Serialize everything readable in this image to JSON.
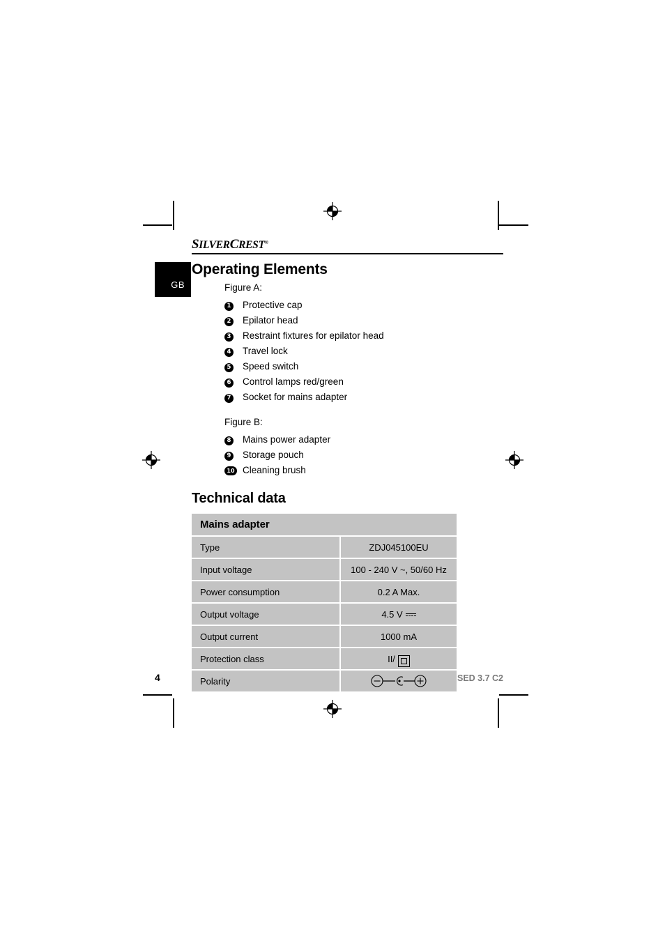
{
  "brand": {
    "name_part1": "S",
    "name_part2": "ILVER",
    "name_part3": "C",
    "name_part4": "REST",
    "registered_mark": "®"
  },
  "language_badge": "GB",
  "sections": {
    "operating_elements": {
      "title": "Operating Elements",
      "figure_a": {
        "label": "Figure A:",
        "items": [
          {
            "number": "1",
            "label": "Protective cap"
          },
          {
            "number": "2",
            "label": "Epilator head"
          },
          {
            "number": "3",
            "label": "Restraint fixtures for epilator head"
          },
          {
            "number": "4",
            "label": "Travel lock"
          },
          {
            "number": "5",
            "label": "Speed switch"
          },
          {
            "number": "6",
            "label": "Control lamps red/green"
          },
          {
            "number": "7",
            "label": "Socket for mains adapter"
          }
        ]
      },
      "figure_b": {
        "label": "Figure B:",
        "items": [
          {
            "number": "8",
            "label": "Mains power adapter"
          },
          {
            "number": "9",
            "label": "Storage pouch"
          },
          {
            "number": "10",
            "label": "Cleaning brush"
          }
        ]
      }
    },
    "technical_data": {
      "title": "Technical data",
      "table_header": "Mains adapter",
      "rows": [
        {
          "label": "Type",
          "value": "ZDJ045100EU",
          "symbol": "none"
        },
        {
          "label": "Input voltage",
          "value": "100 - 240 V ~, 50/60 Hz",
          "symbol": "none"
        },
        {
          "label": "Power consumption",
          "value": "0.2 A Max.",
          "symbol": "none"
        },
        {
          "label": "Output voltage",
          "value": "4.5 V",
          "symbol": "dc-current-icon"
        },
        {
          "label": "Output current",
          "value": "1000 mA",
          "symbol": "none"
        },
        {
          "label": "Protection class",
          "value": "II/",
          "symbol": "class-two-insulation-icon"
        },
        {
          "label": "Polarity",
          "value": "",
          "symbol": "polarity-diagram-icon"
        }
      ]
    }
  },
  "footer": {
    "page_number": "4",
    "model": "SED 3.7 C2"
  },
  "colors": {
    "table_fill": "#c3c3c3",
    "badge_black": "#000000",
    "footer_model": "#7a7a7a"
  }
}
